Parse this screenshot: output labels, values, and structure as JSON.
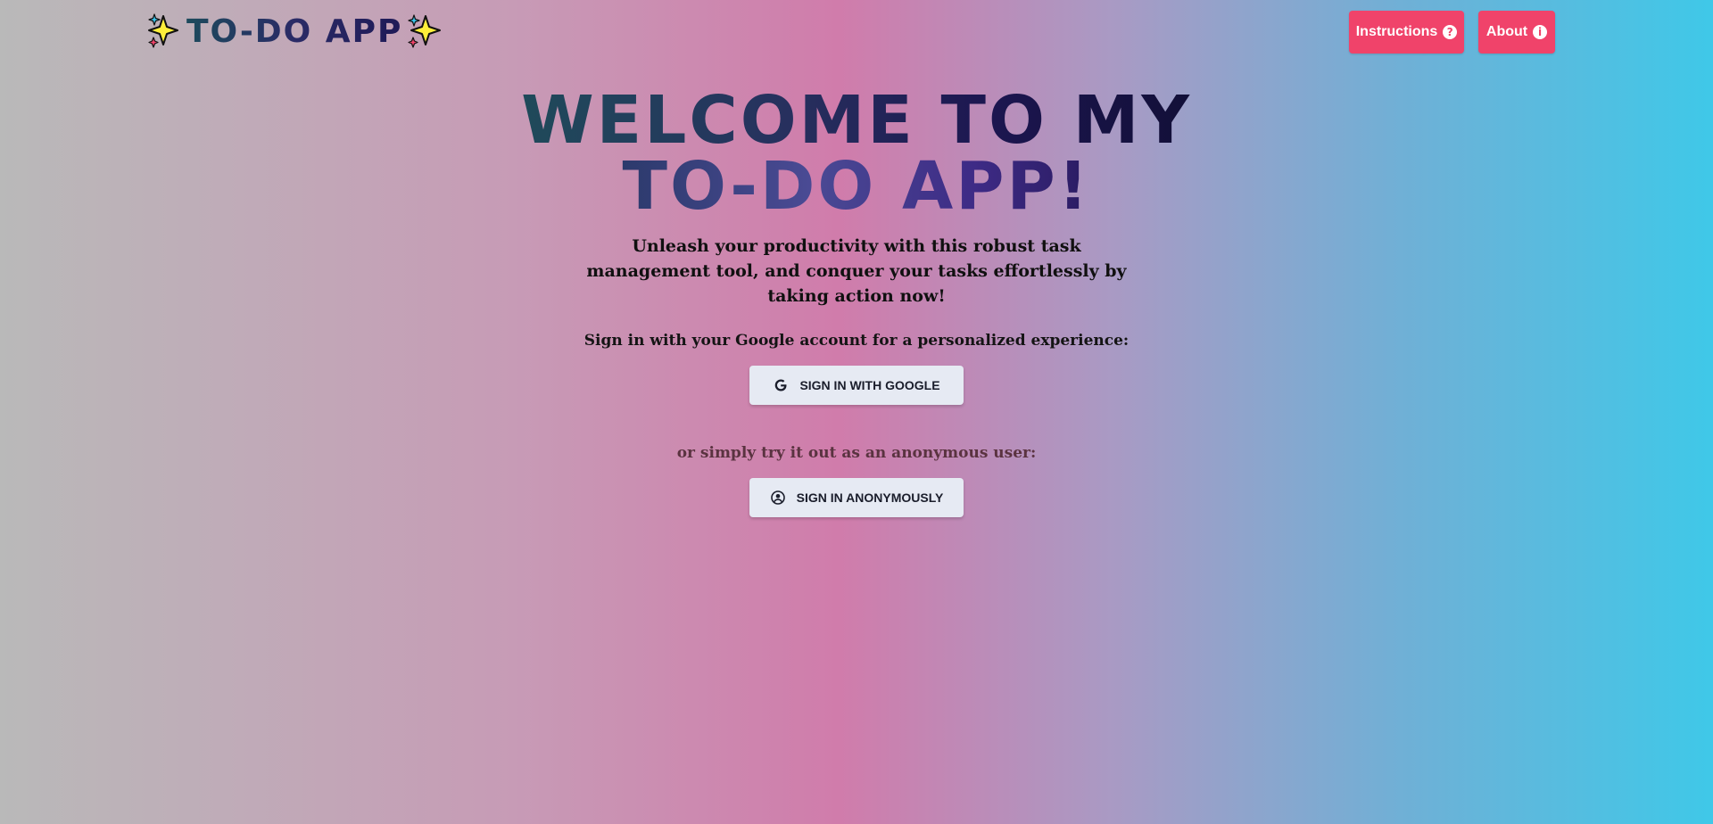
{
  "app": {
    "logo_text": "TO-DO APP",
    "logo_icon_left": "sparkles-icon",
    "logo_icon_right": "sparkles-icon"
  },
  "nav": {
    "instructions_label": "Instructions",
    "instructions_icon": "question-circle-icon",
    "about_label": "About",
    "about_icon": "info-circle-icon",
    "accent_color": "#f0436a"
  },
  "hero": {
    "title_line1": "WELCOME TO MY",
    "title_line2": "TO-DO APP!",
    "tagline": "Unleash your productivity with this robust task management tool, and conquer your tasks effortlessly by taking action now!"
  },
  "auth": {
    "google_prompt": "Sign in with your Google account for a personalized experience:",
    "google_button_label": "SIGN IN WITH GOOGLE",
    "google_icon": "google-icon",
    "anon_prompt": "or simply try it out as an anonymous user:",
    "anon_button_label": "SIGN IN ANONYMOUSLY",
    "anon_icon": "user-circle-icon"
  }
}
